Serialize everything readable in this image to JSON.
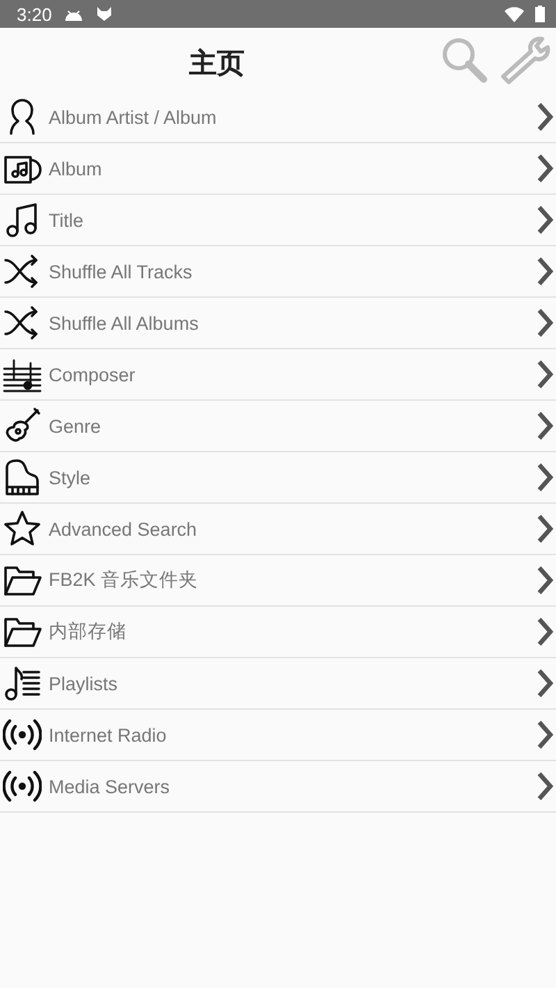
{
  "status_bar": {
    "time": "3:20"
  },
  "header": {
    "title": "主页"
  },
  "items": [
    {
      "label": "Album Artist / Album",
      "kind": "person"
    },
    {
      "label": "Album",
      "kind": "album"
    },
    {
      "label": "Title",
      "kind": "note"
    },
    {
      "label": "Shuffle All Tracks",
      "kind": "shuffle"
    },
    {
      "label": "Shuffle All Albums",
      "kind": "shuffle"
    },
    {
      "label": "Composer",
      "kind": "score"
    },
    {
      "label": "Genre",
      "kind": "guitar"
    },
    {
      "label": "Style",
      "kind": "piano"
    },
    {
      "label": "Advanced Search",
      "kind": "star"
    },
    {
      "label": "FB2K 音乐文件夹",
      "kind": "folder"
    },
    {
      "label": "内部存储",
      "kind": "folder"
    },
    {
      "label": "Playlists",
      "kind": "playlist"
    },
    {
      "label": "Internet Radio",
      "kind": "radio"
    },
    {
      "label": "Media Servers",
      "kind": "radio"
    }
  ]
}
